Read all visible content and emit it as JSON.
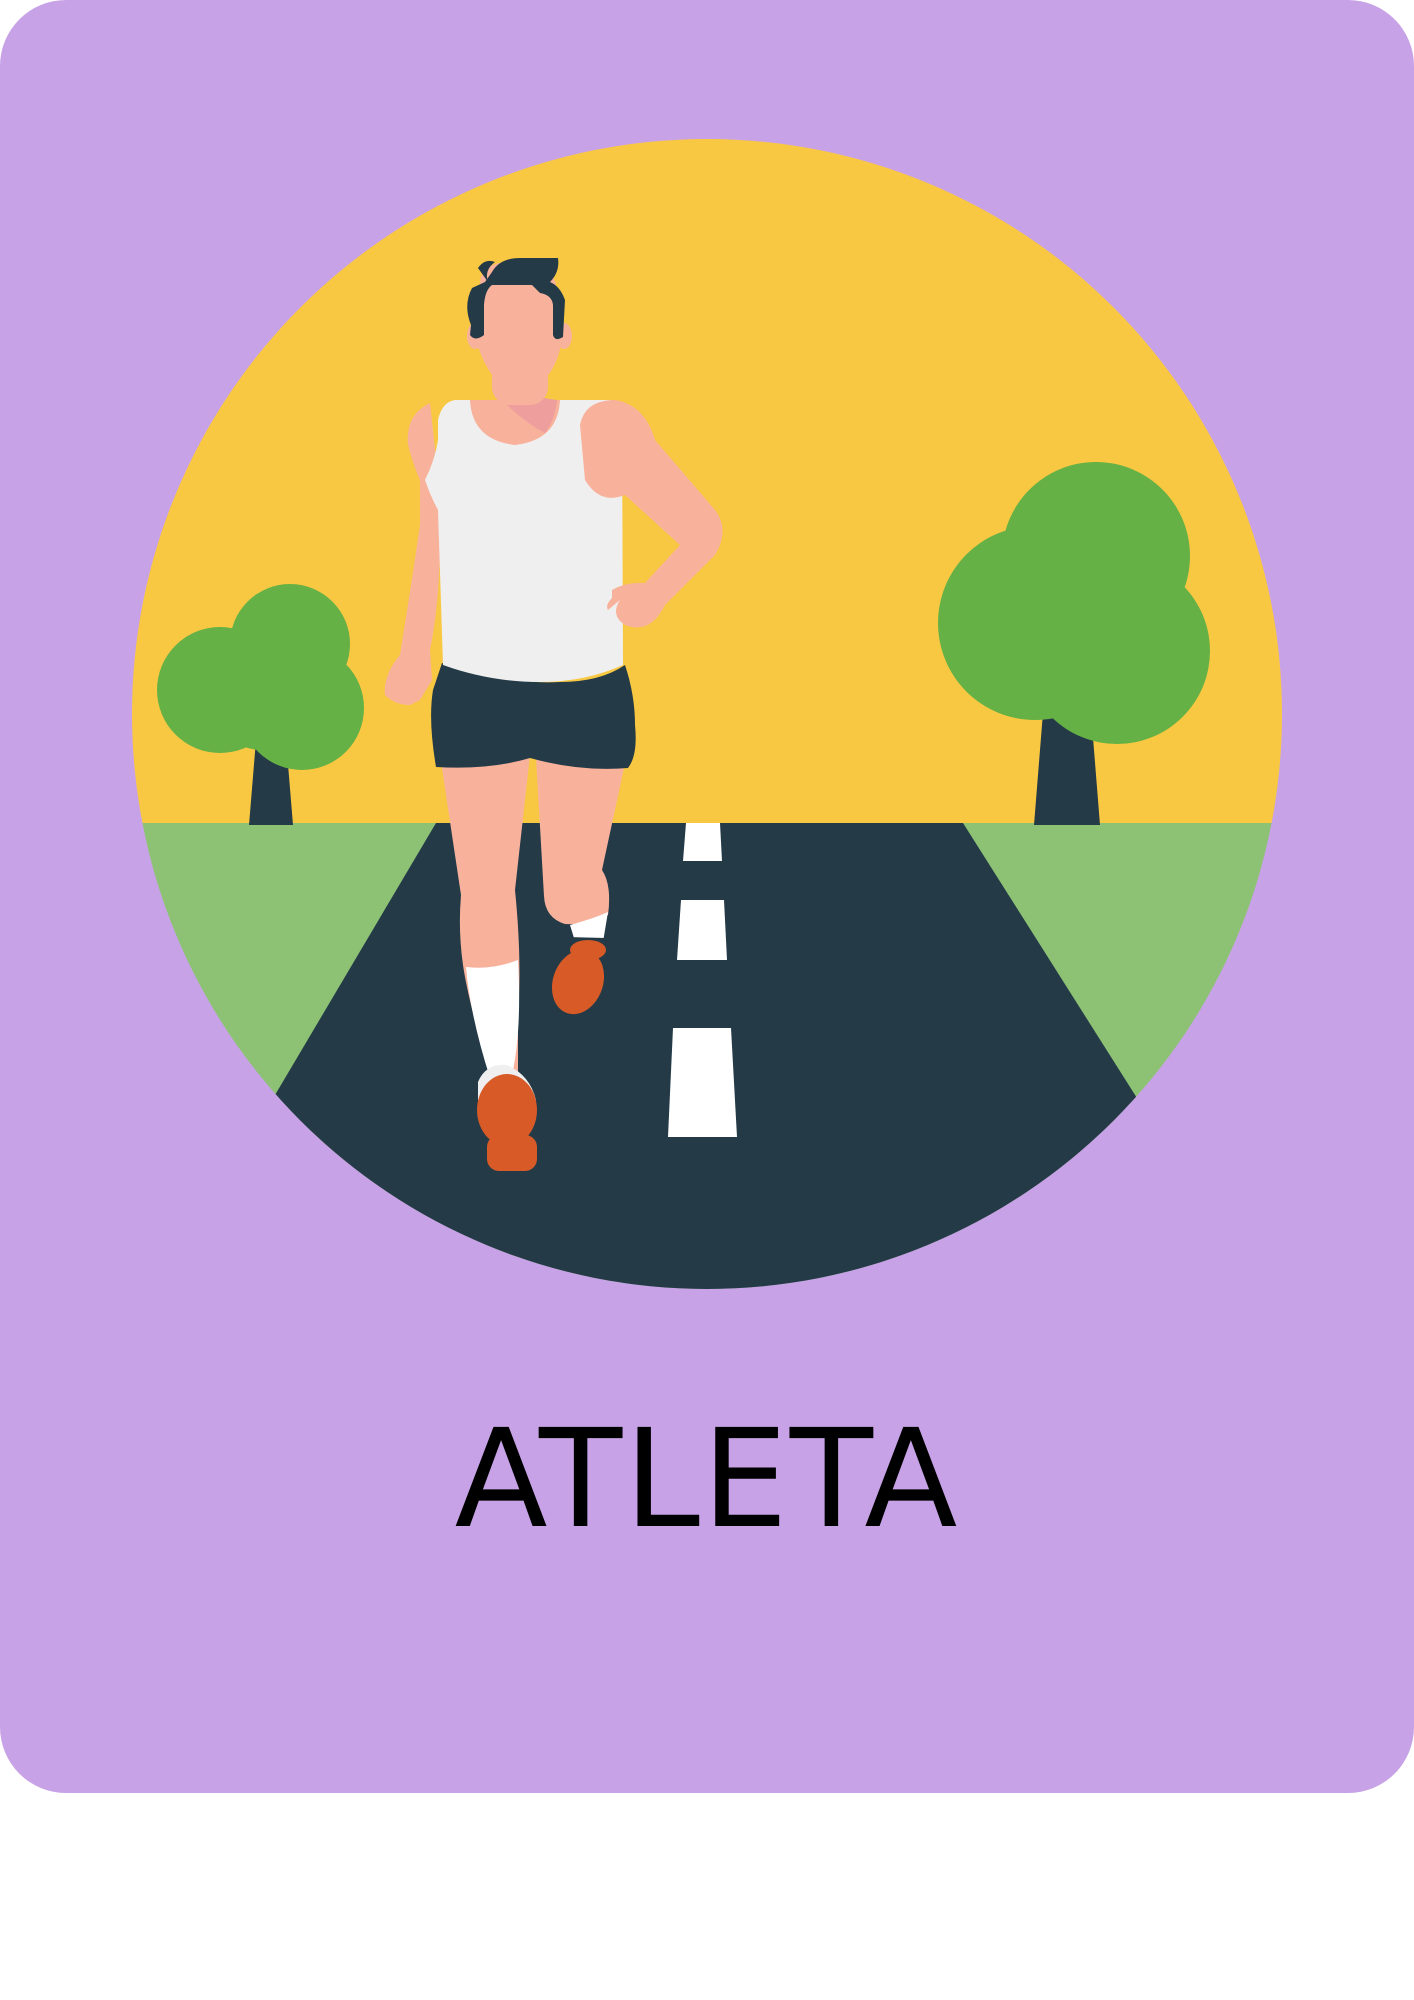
{
  "card": {
    "word": "ATLETA",
    "background_color": "#c8a2e7"
  },
  "illustration": {
    "subject": "runner-on-road",
    "colors": {
      "sky": "#f9c843",
      "grass": "#8dc275",
      "road": "#243a47",
      "road_marking": "#ffffff",
      "tree_foliage": "#65b145",
      "tree_trunk": "#243a47",
      "skin": "#f8b29c",
      "shirt": "#efefef",
      "shorts": "#243a47",
      "shoes": "#d75a27",
      "hair": "#243a47"
    }
  }
}
